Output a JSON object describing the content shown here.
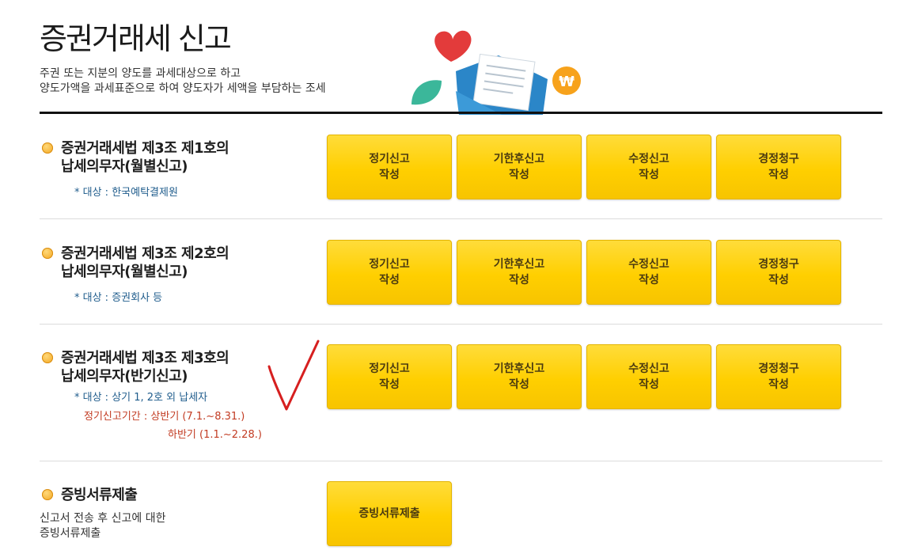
{
  "page": {
    "title": "증권거래세 신고",
    "desc_line1": "주권 또는 지분의 양도를 과세대상으로 하고",
    "desc_line2": "양도가액을 과세표준으로 하여 양도자가 세액을 부담하는 조세"
  },
  "sections": [
    {
      "heading_line1": "증권거래세법 제3조 제1호의",
      "heading_line2": "납세의무자(월별신고)",
      "target": "* 대상 : 한국예탁결제원",
      "buttons": [
        {
          "line1": "정기신고",
          "line2": "작성"
        },
        {
          "line1": "기한후신고",
          "line2": "작성"
        },
        {
          "line1": "수정신고",
          "line2": "작성"
        },
        {
          "line1": "경정청구",
          "line2": "작성"
        }
      ]
    },
    {
      "heading_line1": "증권거래세법 제3조 제2호의",
      "heading_line2": "납세의무자(월별신고)",
      "target": "* 대상 : 증권회사 등",
      "buttons": [
        {
          "line1": "정기신고",
          "line2": "작성"
        },
        {
          "line1": "기한후신고",
          "line2": "작성"
        },
        {
          "line1": "수정신고",
          "line2": "작성"
        },
        {
          "line1": "경정청구",
          "line2": "작성"
        }
      ]
    },
    {
      "heading_line1": "증권거래세법 제3조 제3호의",
      "heading_line2": "납세의무자(반기신고)",
      "target": "* 대상 : 상기 1, 2호 외 납세자",
      "period_line1": "정기신고기간 : 상반기 (7.1.~8.31.)",
      "period_line2": "하반기 (1.1.~2.28.)",
      "buttons": [
        {
          "line1": "정기신고",
          "line2": "작성"
        },
        {
          "line1": "기한후신고",
          "line2": "작성"
        },
        {
          "line1": "수정신고",
          "line2": "작성"
        },
        {
          "line1": "경정청구",
          "line2": "작성"
        }
      ]
    }
  ],
  "evidence": {
    "heading": "증빙서류제출",
    "desc_line1": "신고서 전송 후 신고에 대한",
    "desc_line2": "증빙서류제출",
    "button": "증빙서류제출"
  },
  "colors": {
    "button_fill": "#ffd200",
    "heading_bullet": "#f2a31a",
    "target_text": "#1f5c8c",
    "period_text": "#c23b22",
    "check_mark": "#d61f1f"
  },
  "icons": [
    "heart-icon",
    "envelope-icon",
    "won-coin-icon",
    "leaf-icon",
    "bullet-dot-icon",
    "check-mark-icon"
  ]
}
